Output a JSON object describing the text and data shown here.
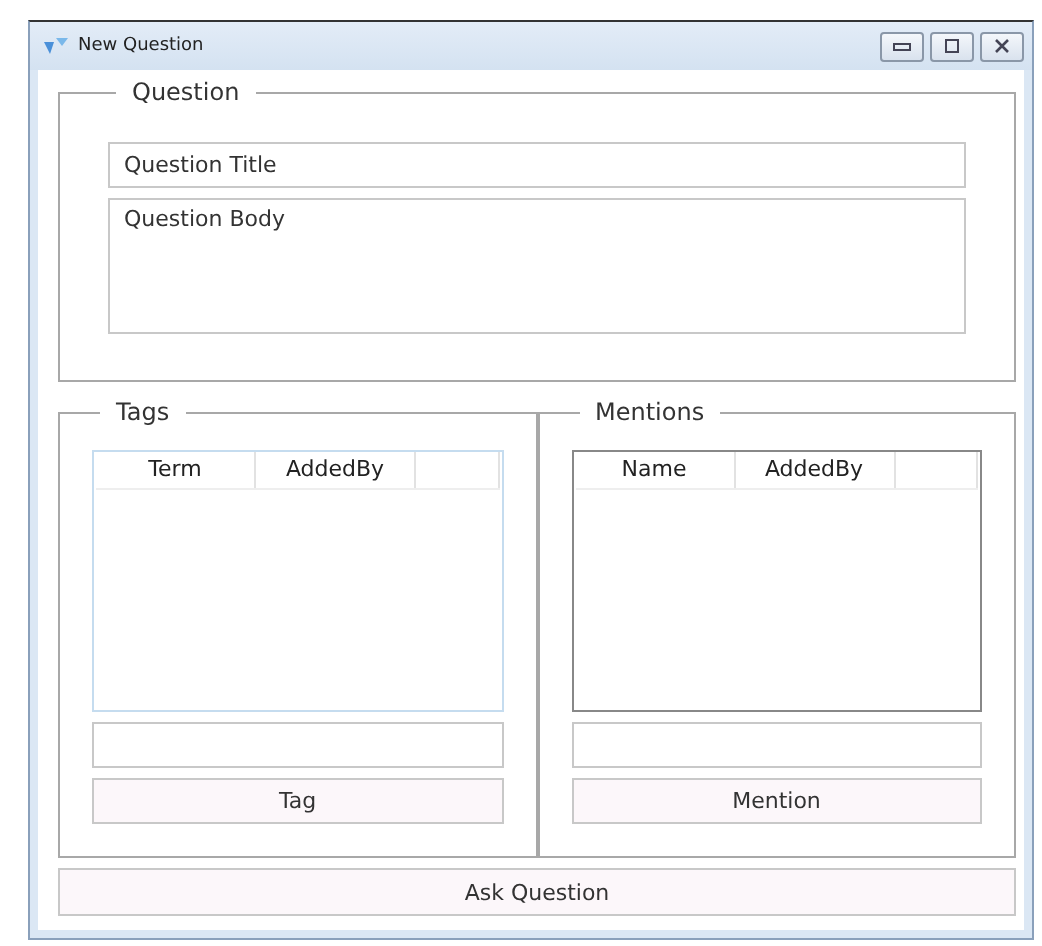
{
  "window": {
    "title": "New Question"
  },
  "question": {
    "legend": "Question",
    "title_field": {
      "value": "Question Title"
    },
    "body_field": {
      "value": "Question Body"
    }
  },
  "panels": [
    {
      "legend": "Tags",
      "grid": {
        "highlighted": true,
        "columns": [
          "Term",
          "AddedBy"
        ]
      },
      "button": "Tag"
    },
    {
      "legend": "Mentions",
      "grid": {
        "highlighted": false,
        "columns": [
          "Name",
          "AddedBy"
        ]
      },
      "button": "Mention"
    }
  ],
  "submit_button": "Ask Question"
}
